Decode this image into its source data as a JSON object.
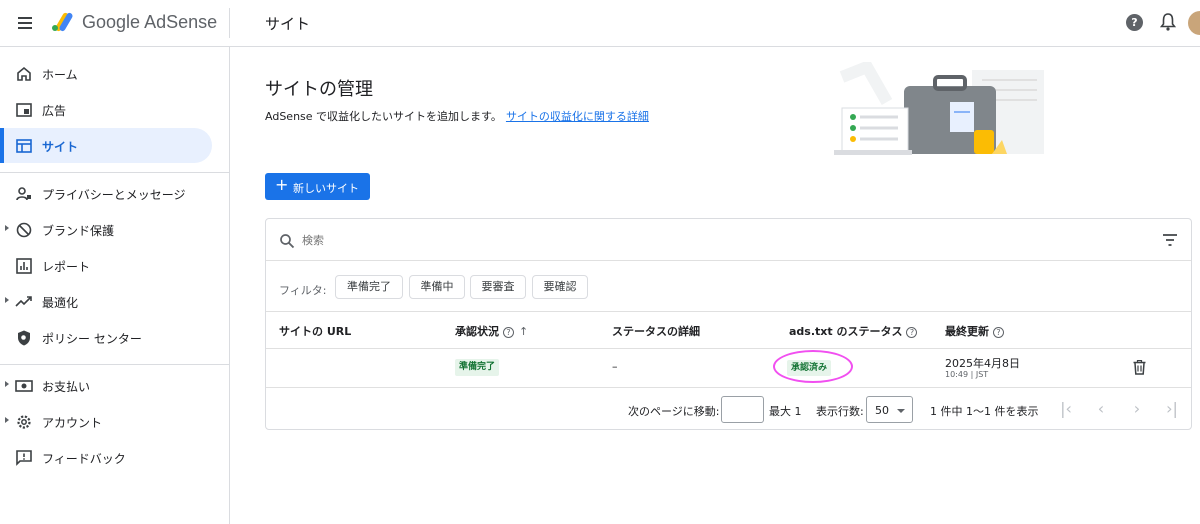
{
  "header": {
    "brand_google": "Google",
    "brand_product": "AdSense",
    "page_title": "サイト",
    "help_glyph": "?"
  },
  "sidebar": {
    "items": [
      {
        "label": "ホーム",
        "icon": "home-icon"
      },
      {
        "label": "広告",
        "icon": "ads-icon"
      },
      {
        "label": "サイト",
        "icon": "sites-icon",
        "active": true
      },
      {
        "label": "プライバシーとメッセージ",
        "icon": "privacy-icon"
      },
      {
        "label": "ブランド保護",
        "icon": "block-icon",
        "expandable": true
      },
      {
        "label": "レポート",
        "icon": "report-icon"
      },
      {
        "label": "最適化",
        "icon": "trending-icon",
        "expandable": true
      },
      {
        "label": "ポリシー センター",
        "icon": "policy-shield-icon"
      },
      {
        "label": "お支払い",
        "icon": "payments-icon",
        "expandable": true
      },
      {
        "label": "アカウント",
        "icon": "gear-icon",
        "expandable": true
      },
      {
        "label": "フィードバック",
        "icon": "feedback-icon"
      }
    ]
  },
  "main": {
    "title": "サイトの管理",
    "subtitle": "AdSense で収益化したいサイトを追加します。",
    "subtitle_link": "サイトの収益化に関する詳細",
    "new_site_button": "新しいサイト",
    "new_site_plus": "+"
  },
  "table": {
    "search_placeholder": "検索",
    "filter_label": "フィルタ:",
    "filter_chips": [
      "準備完了",
      "準備中",
      "要審査",
      "要確認"
    ],
    "columns": [
      "サイトの URL",
      "承認状況",
      "ステータスの詳細",
      "ads.txt のステータス",
      "最終更新"
    ],
    "question_glyph": "?",
    "sort_glyph": "↑",
    "rows": [
      {
        "url": "",
        "approval_status": "準備完了",
        "status_detail": "–",
        "ads_txt_status": "承認済み",
        "last_updated_date": "2025年4月8日",
        "last_updated_time": "10:49 | JST"
      }
    ],
    "pagination": {
      "goto_label": "次のページに移動:",
      "goto_value": "",
      "max_label": "最大 1",
      "rows_label": "表示行数:",
      "rows_value": "50",
      "range_label": "1 件中 1～1 件を表示",
      "first_glyph": "|‹",
      "prev_glyph": "‹",
      "next_glyph": "›",
      "last_glyph": "›|"
    }
  },
  "colors": {
    "accent": "#1a73e8",
    "active_bg": "#e8f0fe",
    "success_bg": "#e6f4ea",
    "success_text": "#137333",
    "highlight_ring": "#f14ff0"
  }
}
